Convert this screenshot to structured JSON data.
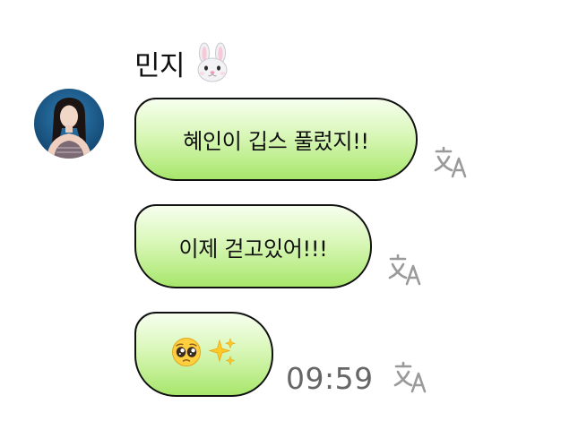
{
  "chat": {
    "sender_name": "민지",
    "sender_name_emoji": "rabbit-face-icon",
    "messages": [
      {
        "text": "혜인이 깁스 풀렀지!!"
      },
      {
        "text": "이제 걷고있어!!!"
      },
      {
        "emoji": [
          "pleading-face-icon",
          "sparkles-icon"
        ]
      }
    ],
    "timestamp": "09:59"
  },
  "colors": {
    "bubble_gradient_top": "#f6ffee",
    "bubble_gradient_bottom": "#a8e66b",
    "bubble_border": "#111111",
    "translate_icon": "#9a9a9a",
    "timestamp": "#666666"
  },
  "icons": {
    "translate": "translate-icon",
    "avatar": "avatar"
  }
}
